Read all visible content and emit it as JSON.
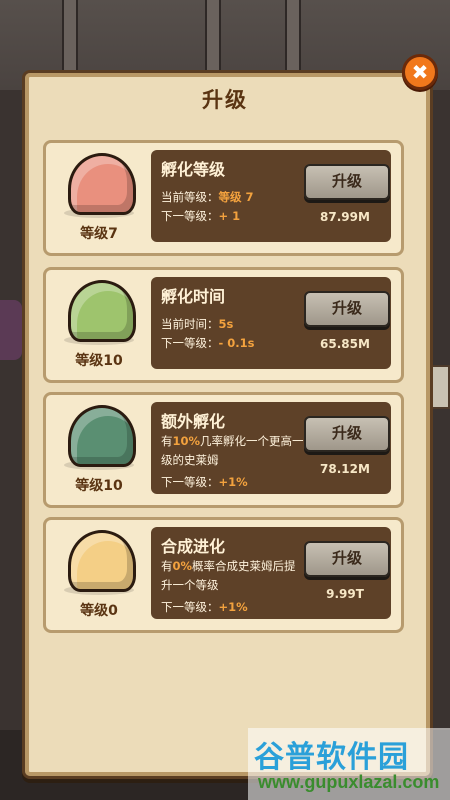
{
  "dialog": {
    "title": "升级",
    "close_icon_glyph": "✖"
  },
  "upgrades": [
    {
      "name": "孵化等级",
      "level_label": "等级7",
      "slime_color": "#e9907e",
      "current_prefix": "当前等级：",
      "current_value": "等级 7",
      "next_prefix": "下一等级：",
      "next_value": "+ 1",
      "button_label": "升级",
      "cost": "87.99M"
    },
    {
      "name": "孵化时间",
      "level_label": "等级10",
      "slime_color": "#9ec46d",
      "current_prefix": "当前时间：",
      "current_value": "5s",
      "next_prefix": "下一等级：",
      "next_value": "- 0.1s",
      "button_label": "升级",
      "cost": "65.85M"
    },
    {
      "name": "额外孵化",
      "level_label": "等级10",
      "slime_color": "#5a8f72",
      "desc_1": "有",
      "desc_highlight": "10%",
      "desc_2": "几率孵化一个更高一级的史莱姆",
      "next_prefix": "下一等级：",
      "next_value": "+1%",
      "button_label": "升级",
      "cost": "78.12M"
    },
    {
      "name": "合成进化",
      "level_label": "等级0",
      "slime_color": "#f4cf86",
      "desc_1": "有",
      "desc_highlight": "0%",
      "desc_2": "概率合成史莱姆后提升一个等级",
      "next_prefix": "下一等级：",
      "next_value": "+1%",
      "button_label": "升级",
      "cost": "9.99T"
    }
  ],
  "watermark": {
    "main": "谷普软件园",
    "url": "www.gupuxlazal.com"
  }
}
